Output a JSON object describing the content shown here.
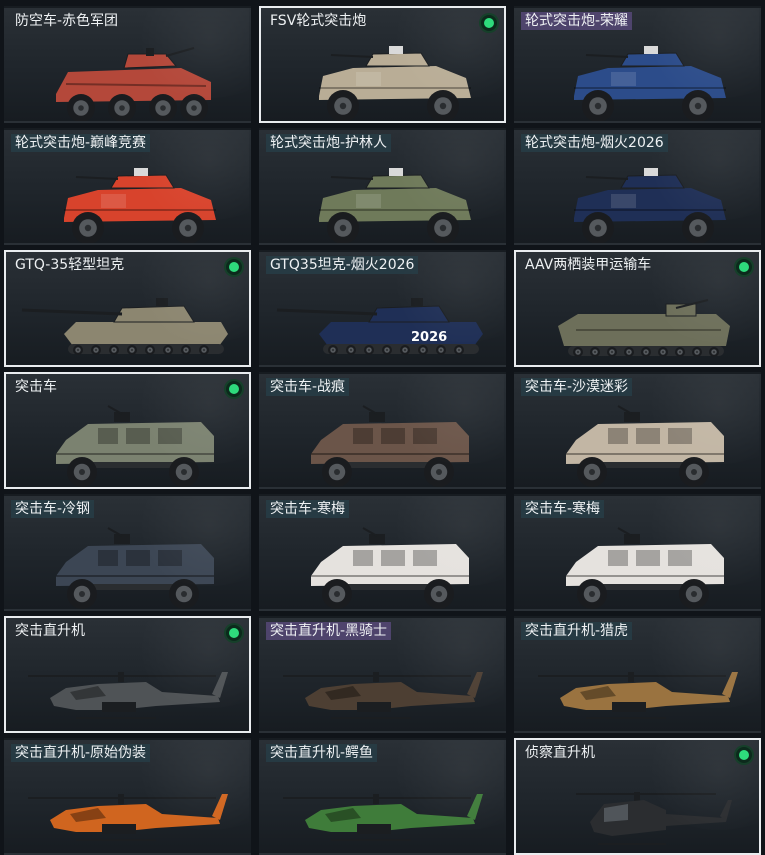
{
  "palette": {
    "red-camo": "#b4483a",
    "sand": "#b9ad96",
    "blue-white": "#2c4c8a",
    "red-white": "#d8432c",
    "green-camo": "#6f7a5a",
    "navy": "#1f2f56",
    "tan-camo": "#8c8670",
    "olive": "#6d6f5a",
    "olive-grey": "#7b8270",
    "brown-camo": "#6b5549",
    "desert-camo": "#c2b6a4",
    "steel-blue": "#3c4654",
    "white-pink": "#e5e2de",
    "charcoal": "#4f5356",
    "dark-brown": "#4d3f33",
    "tiger": "#9a7340",
    "black-orange": "#d0651f",
    "black-green": "#3f7c3a",
    "black": "#2b2d30"
  },
  "vehicles": [
    {
      "name": "防空车-赤色军团",
      "label_style": "plain",
      "type": "aa",
      "color": "red-camo",
      "icon": "anti-air-vehicle-icon",
      "selected": false,
      "equipped": false
    },
    {
      "name": "FSV轮式突击炮",
      "label_style": "plain",
      "type": "wheeled",
      "color": "sand",
      "icon": "wheeled-assault-gun-icon",
      "selected": true,
      "equipped": true
    },
    {
      "name": "轮式突击炮-荣耀",
      "label_style": "premium",
      "type": "wheeled",
      "color": "blue-white",
      "icon": "wheeled-assault-gun-icon",
      "selected": false,
      "equipped": false
    },
    {
      "name": "轮式突击炮-巅峰竞赛",
      "label_style": "standard",
      "type": "wheeled",
      "color": "red-white",
      "icon": "wheeled-assault-gun-icon",
      "selected": false,
      "equipped": false
    },
    {
      "name": "轮式突击炮-护林人",
      "label_style": "standard",
      "type": "wheeled",
      "color": "green-camo",
      "icon": "wheeled-assault-gun-icon",
      "selected": false,
      "equipped": false
    },
    {
      "name": "轮式突击炮-烟火2026",
      "label_style": "standard",
      "type": "wheeled",
      "color": "navy",
      "icon": "wheeled-assault-gun-icon",
      "selected": false,
      "equipped": false
    },
    {
      "name": "GTQ-35轻型坦克",
      "label_style": "plain",
      "type": "tank",
      "color": "tan-camo",
      "icon": "light-tank-icon",
      "selected": true,
      "equipped": true
    },
    {
      "name": "GTQ35坦克-烟火2026",
      "label_style": "standard",
      "type": "tank",
      "color": "navy",
      "icon": "light-tank-icon",
      "text_on_hull": "2026",
      "selected": false,
      "equipped": false
    },
    {
      "name": "AAV两栖装甲运输车",
      "label_style": "plain",
      "type": "aav",
      "color": "olive",
      "icon": "amphibious-vehicle-icon",
      "selected": true,
      "equipped": true
    },
    {
      "name": "突击车",
      "label_style": "plain",
      "type": "assault",
      "color": "olive-grey",
      "icon": "assault-vehicle-icon",
      "selected": true,
      "equipped": true
    },
    {
      "name": "突击车-战痕",
      "label_style": "standard",
      "type": "assault",
      "color": "brown-camo",
      "icon": "assault-vehicle-icon",
      "selected": false,
      "equipped": false
    },
    {
      "name": "突击车-沙漠迷彩",
      "label_style": "standard",
      "type": "assault",
      "color": "desert-camo",
      "icon": "assault-vehicle-icon",
      "selected": false,
      "equipped": false
    },
    {
      "name": "突击车-冷钢",
      "label_style": "standard",
      "type": "assault",
      "color": "steel-blue",
      "icon": "assault-vehicle-icon",
      "selected": false,
      "equipped": false
    },
    {
      "name": "突击车-寒梅",
      "label_style": "standard",
      "type": "assault",
      "color": "white-pink",
      "icon": "assault-vehicle-icon",
      "selected": false,
      "equipped": false
    },
    {
      "name": "突击车-寒梅",
      "label_style": "standard",
      "type": "assault",
      "color": "white-pink",
      "icon": "assault-vehicle-icon",
      "selected": false,
      "equipped": false
    },
    {
      "name": "突击直升机",
      "label_style": "plain",
      "type": "heli",
      "color": "charcoal",
      "icon": "attack-helicopter-icon",
      "selected": true,
      "equipped": true
    },
    {
      "name": "突击直升机-黑骑士",
      "label_style": "premium",
      "type": "heli",
      "color": "dark-brown",
      "icon": "attack-helicopter-icon",
      "selected": false,
      "equipped": false
    },
    {
      "name": "突击直升机-猎虎",
      "label_style": "standard",
      "type": "heli",
      "color": "tiger",
      "icon": "attack-helicopter-icon",
      "selected": false,
      "equipped": false
    },
    {
      "name": "突击直升机-原始伪装",
      "label_style": "standard",
      "type": "heli",
      "color": "black-orange",
      "icon": "attack-helicopter-icon",
      "selected": false,
      "equipped": false
    },
    {
      "name": "突击直升机-鳄鱼",
      "label_style": "standard",
      "type": "heli",
      "color": "black-green",
      "icon": "attack-helicopter-icon",
      "selected": false,
      "equipped": false
    },
    {
      "name": "侦察直升机",
      "label_style": "plain",
      "type": "scout",
      "color": "black",
      "icon": "scout-helicopter-icon",
      "selected": true,
      "equipped": true
    }
  ]
}
